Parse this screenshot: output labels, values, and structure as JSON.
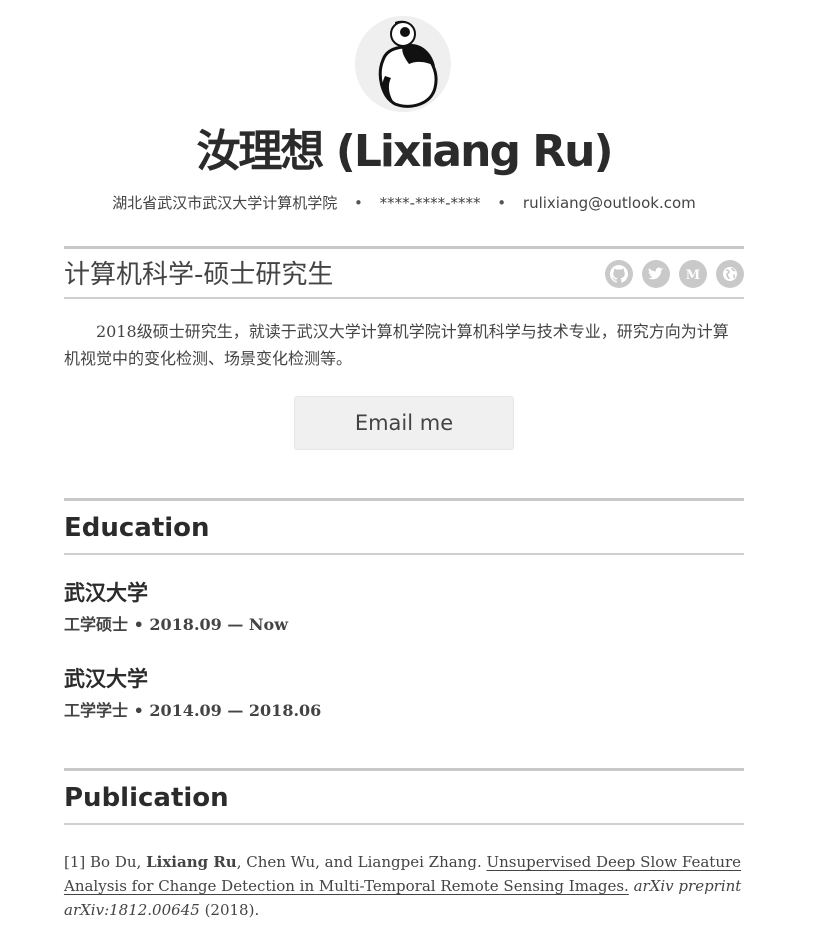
{
  "header": {
    "name": "汝理想 (Lixiang Ru)",
    "location": "湖北省武汉市武汉大学计算机学院",
    "phone": "****-****-****",
    "email": "rulixiang@outlook.com",
    "separator": "•"
  },
  "profile": {
    "position": "计算机科学-硕士研究生",
    "social_icons": [
      "github-icon",
      "twitter-icon",
      "medium-icon",
      "globe-icon"
    ],
    "about": "2018级硕士研究生，就读于武汉大学计算机学院计算机科学与技术专业，研究方向为计算机视觉中的变化检测、场景变化检测等。",
    "email_button": "Email me"
  },
  "education": {
    "title": "Education",
    "items": [
      {
        "school": "武汉大学",
        "degree": "工学硕士",
        "period": "2018.09 — Now"
      },
      {
        "school": "武汉大学",
        "degree": "工学学士",
        "period": "2014.09 — 2018.06"
      }
    ]
  },
  "publication": {
    "title": "Publication",
    "items": [
      {
        "index": "[1]",
        "authors_before": "Bo Du,",
        "author_self": "Lixiang Ru",
        "authors_after": ", Chen Wu, and Liangpei Zhang.",
        "paper_title": "Unsupervised Deep Slow Feature Analysis for Change Detection in Multi-Temporal Remote Sensing Images.",
        "venue": "arXiv preprint arXiv:1812.00645",
        "year": "(2018)."
      }
    ]
  },
  "colors": {
    "text": "#333333",
    "rule": "#c8c8c8",
    "icon_bg": "#c9c9c9",
    "button_bg": "#f0f0f0"
  }
}
